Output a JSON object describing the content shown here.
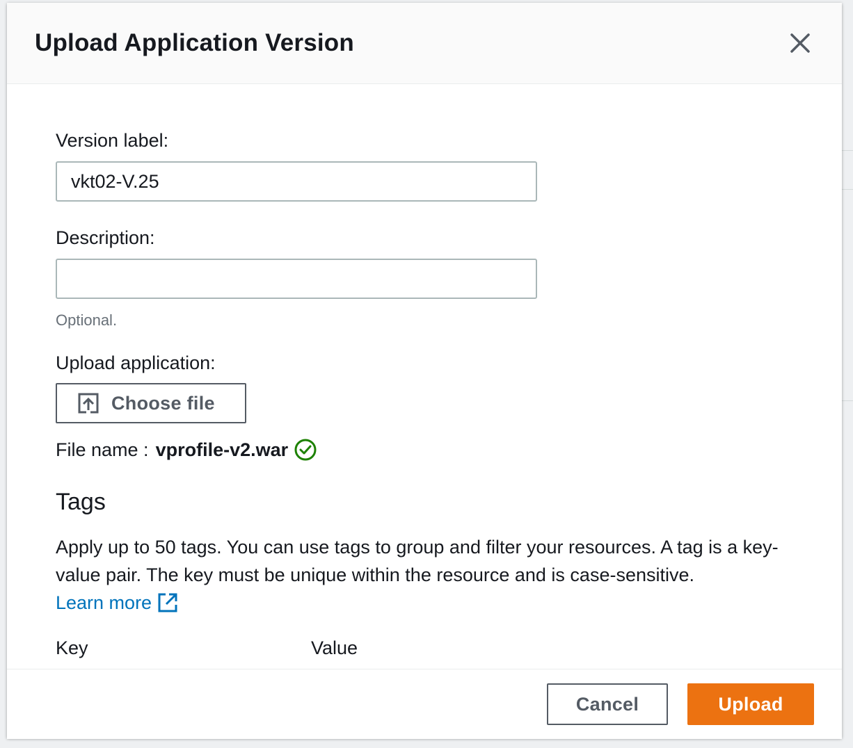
{
  "modal": {
    "title": "Upload Application Version"
  },
  "form": {
    "version_label": "Version label:",
    "version_value": "vkt02-V.25",
    "description_label": "Description:",
    "description_value": "",
    "description_hint": "Optional.",
    "upload_label": "Upload application:",
    "choose_file_label": "Choose file",
    "file_name_prefix": "File name :",
    "file_name": "vprofile-v2.war"
  },
  "tags": {
    "heading": "Tags",
    "description": "Apply up to 50 tags. You can use tags to group and filter your resources. A tag is a key-value pair. The key must be unique within the resource and is case-sensitive.",
    "learn_more": "Learn more",
    "key_header": "Key",
    "value_header": "Value"
  },
  "footer": {
    "cancel_label": "Cancel",
    "upload_label": "Upload"
  },
  "colors": {
    "primary": "#ec7211",
    "link": "#0073bb",
    "success": "#1d8102",
    "border": "#aab7b8"
  },
  "icons": {
    "close": "close-icon",
    "upload": "upload-icon",
    "success": "check-circle-icon",
    "external": "external-link-icon"
  }
}
